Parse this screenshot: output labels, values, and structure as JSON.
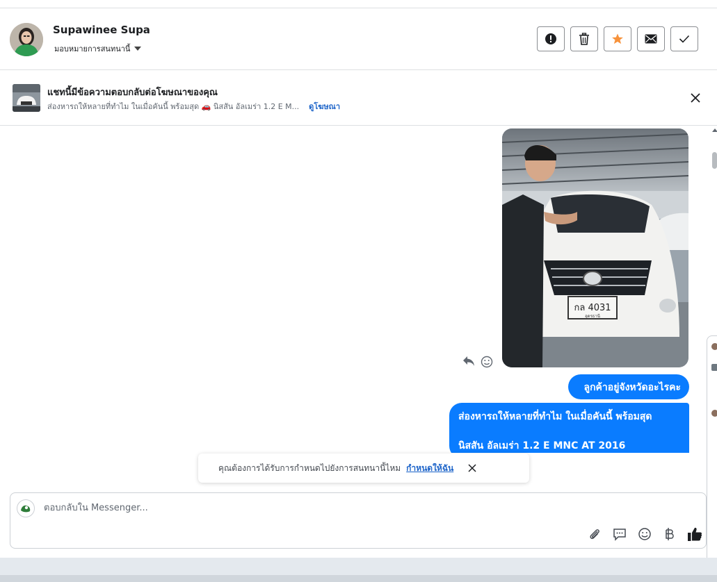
{
  "header": {
    "name": "Supawinee Supa",
    "assign_label": "มอบหมายการสนทนานี้"
  },
  "header_actions": [
    {
      "name": "alert-icon"
    },
    {
      "name": "trash-icon"
    },
    {
      "name": "star-icon",
      "color": "#f7923b"
    },
    {
      "name": "mail-icon"
    },
    {
      "name": "check-icon"
    }
  ],
  "ad_banner": {
    "title": "แชทนี้มีข้อความตอบกลับต่อโฆษณาของคุณ",
    "subtitle": "ส่องหารถให้หลายที่ทำไม ในเมื่อคันนี้ พร้อมสุด 🚗 นิสสัน อัลเมร่า 1.2 E M...",
    "link": "ดูโฆษณา"
  },
  "messages": {
    "m1": "ลูกค้าอยู่จังหวัดอะไรคะ",
    "m2_line1": "ส่องหารถให้หลายที่ทำไม  ในเมื่อคันนี้ พร้อมสุด",
    "m2_line2": "นิสสัน  อัลเมร่า 1.2 E MNC AT 2016",
    "plate": "กล 4031",
    "plate_province": "อุดรธานี"
  },
  "snackbar": {
    "text": "คุณต้องการได้รับการกำหนดไปยังการสนทนานี้ไหม",
    "link": "กำหนดให้ฉัน"
  },
  "composer": {
    "placeholder": "ตอบกลับใน Messenger..."
  },
  "composer_tools": [
    "paperclip-icon",
    "saved-reply-icon",
    "emoji-icon",
    "baht-icon",
    "thumbs-up-icon"
  ],
  "colors": {
    "accent": "#0a7cff",
    "link": "#1d64c9"
  }
}
